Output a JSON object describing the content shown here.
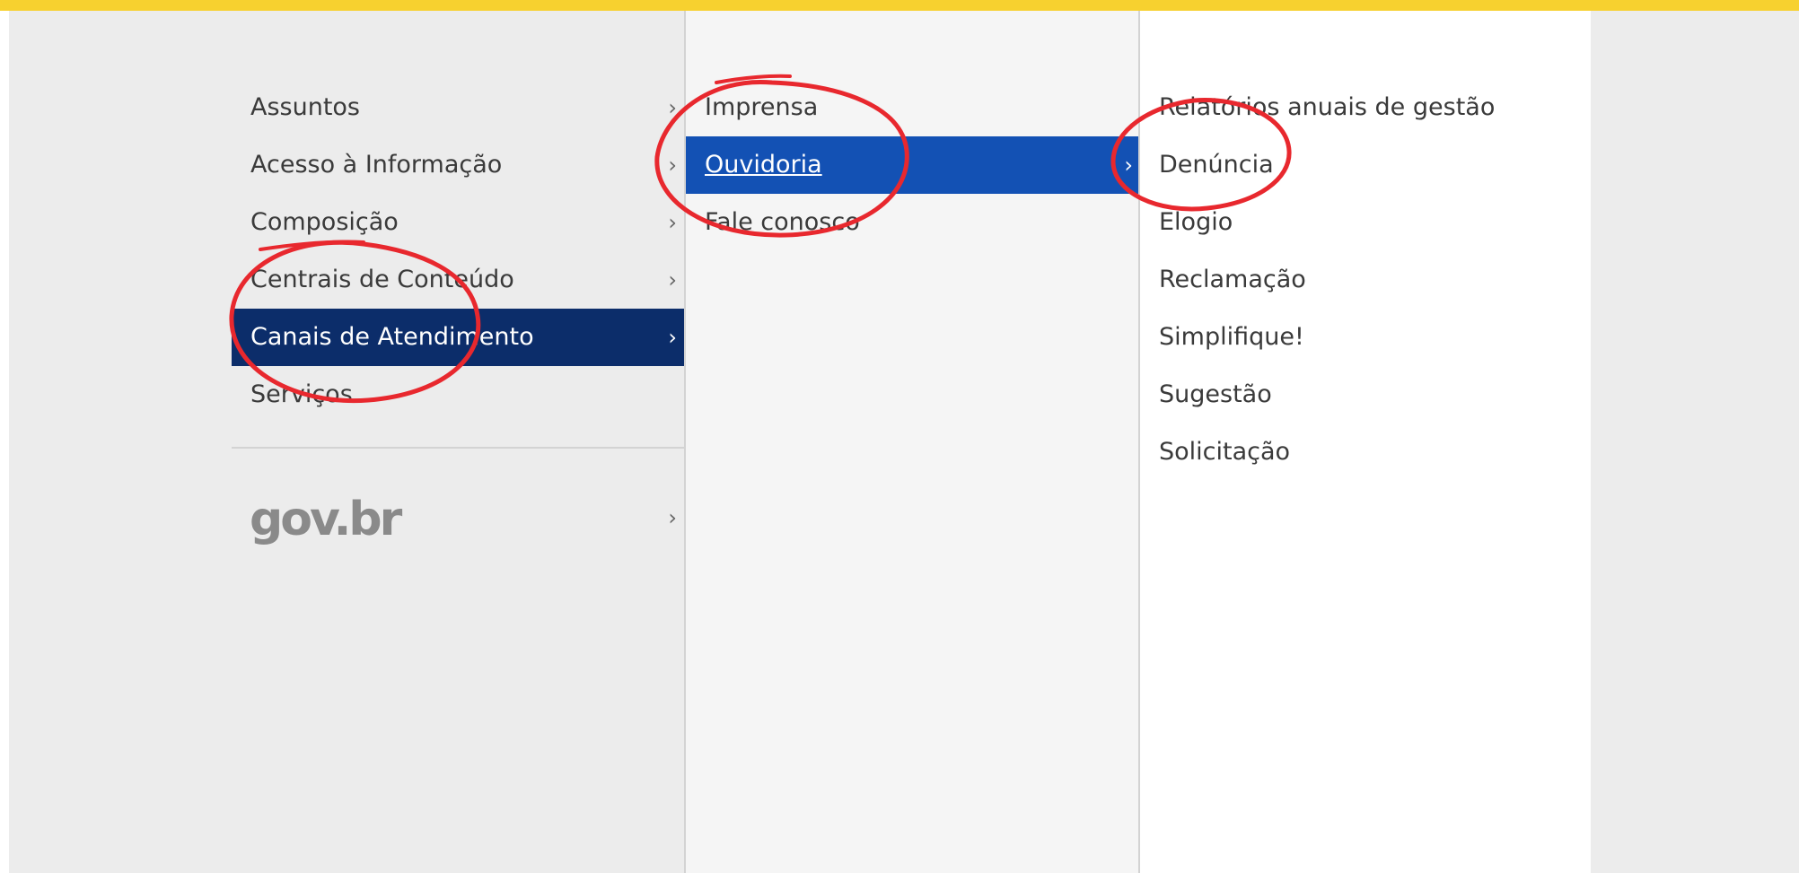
{
  "level1": {
    "items": [
      {
        "label": "Assuntos"
      },
      {
        "label": "Acesso à Informação"
      },
      {
        "label": "Composição"
      },
      {
        "label": "Centrais de Conteúdo"
      },
      {
        "label": "Canais de Atendimento"
      },
      {
        "label": "Serviços"
      }
    ],
    "active_index": 4,
    "govbr_label": "gov.br"
  },
  "level2": {
    "items": [
      {
        "label": "Imprensa"
      },
      {
        "label": "Ouvidoria"
      },
      {
        "label": "Fale conosco"
      }
    ],
    "active_index": 1
  },
  "level3": {
    "items": [
      {
        "label": "Relatórios anuais de gestão"
      },
      {
        "label": "Denúncia"
      },
      {
        "label": "Elogio"
      },
      {
        "label": "Reclamação"
      },
      {
        "label": "Simplifique!"
      },
      {
        "label": "Sugestão"
      },
      {
        "label": "Solicitação"
      }
    ]
  },
  "colors": {
    "top_line": "#f7d12f",
    "active_dark": "#0c2d6a",
    "active_blue": "#1351b4",
    "annotation": "#e8282e"
  },
  "chevron_glyph": "›"
}
